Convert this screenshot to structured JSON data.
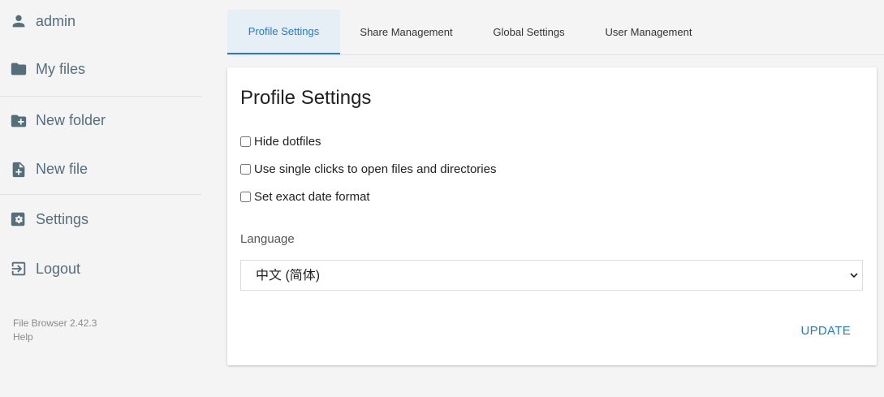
{
  "sidebar": {
    "items": [
      {
        "label": "admin",
        "icon": "person-icon"
      },
      {
        "label": "My files",
        "icon": "folder-icon"
      },
      {
        "label": "New folder",
        "icon": "create-new-folder-icon"
      },
      {
        "label": "New file",
        "icon": "note-add-icon"
      },
      {
        "label": "Settings",
        "icon": "settings-icon"
      },
      {
        "label": "Logout",
        "icon": "exit-icon"
      }
    ],
    "footer": {
      "version": "File Browser 2.42.3",
      "help": "Help"
    }
  },
  "tabs": [
    {
      "label": "Profile Settings",
      "active": true
    },
    {
      "label": "Share Management",
      "active": false
    },
    {
      "label": "Global Settings",
      "active": false
    },
    {
      "label": "User Management",
      "active": false
    }
  ],
  "card": {
    "title": "Profile Settings",
    "options": [
      {
        "label": "Hide dotfiles",
        "checked": false
      },
      {
        "label": "Use single clicks to open files and directories",
        "checked": false
      },
      {
        "label": "Set exact date format",
        "checked": false
      }
    ],
    "language_label": "Language",
    "language_value": "中文 (简体)",
    "update_label": "UPDATE"
  },
  "colors": {
    "accent": "#2979c9",
    "icon": "#546e7a",
    "active_tab_bg": "#e6eef6"
  }
}
